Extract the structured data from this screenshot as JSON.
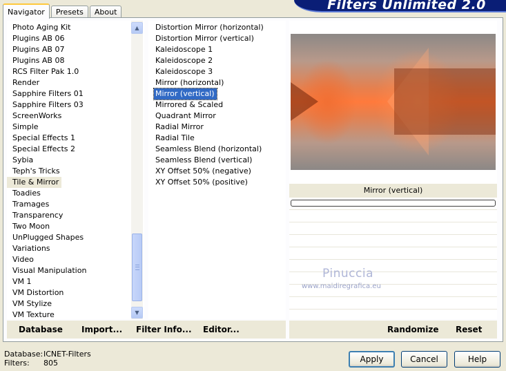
{
  "tabs": [
    {
      "label": "Navigator",
      "active": true
    },
    {
      "label": "Presets",
      "active": false
    },
    {
      "label": "About",
      "active": false
    }
  ],
  "banner": {
    "title": "Filters Unlimited 2.0"
  },
  "categories": {
    "items": [
      "Photo Aging Kit",
      "Plugins AB 06",
      "Plugins AB 07",
      "Plugins AB 08",
      "RCS Filter Pak 1.0",
      "Render",
      "Sapphire Filters 01",
      "Sapphire Filters 03",
      "ScreenWorks",
      "Simple",
      "Special Effects 1",
      "Special Effects 2",
      "Sybia",
      "Teph's Tricks",
      "Tile & Mirror",
      "Toadies",
      "Tramages",
      "Transparency",
      "Two Moon",
      "UnPlugged Shapes",
      "Variations",
      "Video",
      "Visual Manipulation",
      "VM 1",
      "VM Distortion",
      "VM Stylize",
      "VM Texture"
    ],
    "selected": "Tile & Mirror"
  },
  "filters": {
    "items": [
      "Distortion Mirror (horizontal)",
      "Distortion Mirror (vertical)",
      "Kaleidoscope 1",
      "Kaleidoscope 2",
      "Kaleidoscope 3",
      "Mirror (horizontal)",
      "Mirror (vertical)",
      "Mirrored & Scaled",
      "Quadrant Mirror",
      "Radial Mirror",
      "Radial Tile",
      "Seamless Blend (horizontal)",
      "Seamless Blend (vertical)",
      "XY Offset 50% (negative)",
      "XY Offset 50% (positive)"
    ],
    "selected": "Mirror (vertical)"
  },
  "preview": {
    "filter_name": "Mirror (vertical)"
  },
  "watermark": {
    "name": "Pinuccia",
    "site": "www.maidiregrafica.eu"
  },
  "toolbar": {
    "database": "Database",
    "import": "Import...",
    "filter_info": "Filter Info...",
    "editor": "Editor...",
    "randomize": "Randomize",
    "reset": "Reset"
  },
  "status": {
    "database_label": "Database:",
    "database_value": "ICNET-Filters",
    "filters_label": "Filters:",
    "filters_value": "805"
  },
  "buttons": {
    "apply": "Apply",
    "cancel": "Cancel",
    "help": "Help"
  }
}
